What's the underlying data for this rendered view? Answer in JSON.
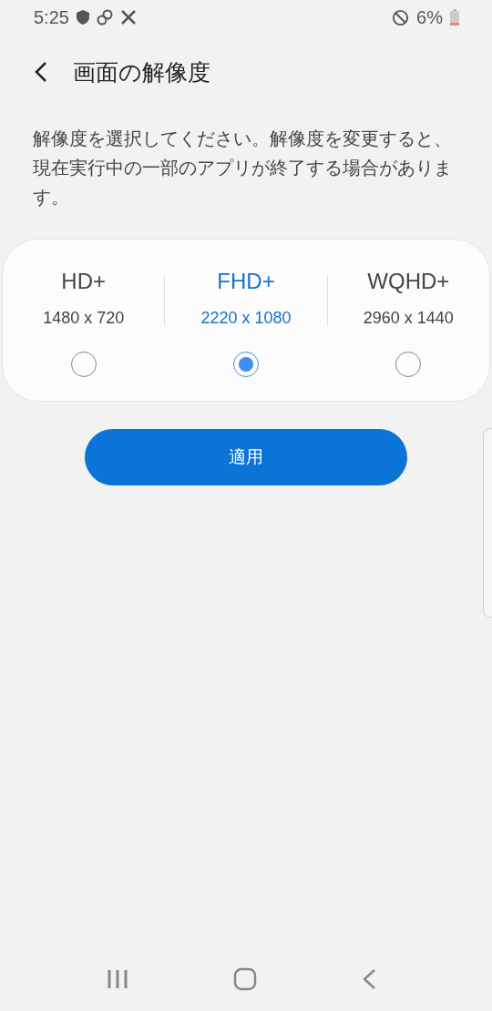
{
  "status_bar": {
    "time": "5:25",
    "battery": "6%"
  },
  "header": {
    "title": "画面の解像度"
  },
  "description": "解像度を選択してください。解像度を変更すると、現在実行中の一部のアプリが終了する場合があります。",
  "options": [
    {
      "name": "HD+",
      "resolution": "1480 x 720",
      "selected": false
    },
    {
      "name": "FHD+",
      "resolution": "2220 x 1080",
      "selected": true
    },
    {
      "name": "WQHD+",
      "resolution": "2960 x 1440",
      "selected": false
    }
  ],
  "apply_button": "適用"
}
